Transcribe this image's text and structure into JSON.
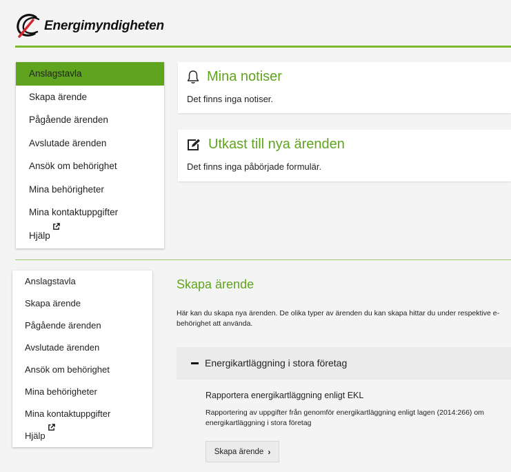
{
  "brand": {
    "name": "Energimyndigheten",
    "color": "#5fa31e"
  },
  "menu_top": {
    "items": [
      {
        "label": "Anslagstavla",
        "active": true
      },
      {
        "label": "Skapa ärende"
      },
      {
        "label": "Pågående ärenden"
      },
      {
        "label": "Avslutade ärenden"
      },
      {
        "label": "Ansök om behörighet"
      },
      {
        "label": "Mina behörigheter"
      },
      {
        "label": "Mina kontaktuppgifter"
      },
      {
        "label": "Hjälp",
        "external": true
      }
    ]
  },
  "notices": {
    "title": "Mina notiser",
    "icon": "bell-icon",
    "text": "Det finns inga notiser."
  },
  "drafts": {
    "title": "Utkast till nya ärenden",
    "icon": "edit-icon",
    "text": "Det finns inga påbörjade formulär."
  },
  "menu_bottom": {
    "items": [
      {
        "label": "Anslagstavla"
      },
      {
        "label": "Skapa ärende"
      },
      {
        "label": "Pågående ärenden"
      },
      {
        "label": "Avslutade ärenden"
      },
      {
        "label": "Ansök om behörighet"
      },
      {
        "label": "Mina behörigheter"
      },
      {
        "label": "Mina kontaktuppgifter"
      },
      {
        "label": "Hjälp",
        "external": true
      }
    ]
  },
  "create_case": {
    "title": "Skapa ärende",
    "description_line1": "Här kan du skapa nya ärenden. De olika typer av ärenden du kan skapa hittar du under respektive e-",
    "description_line2": "behörighet att använda.",
    "accordion": {
      "label": "Energikartläggning i stora företag",
      "item_title": "Rapportera energikartläggning enligt EKL",
      "item_desc_line1": "Rapportering av uppgifter från genomför energikartläggning enligt lagen (2014:266) om",
      "item_desc_line2": "energikartläggning i stora företag",
      "button_label": "Skapa ärende",
      "button_icon": "chevron-right-icon"
    }
  }
}
